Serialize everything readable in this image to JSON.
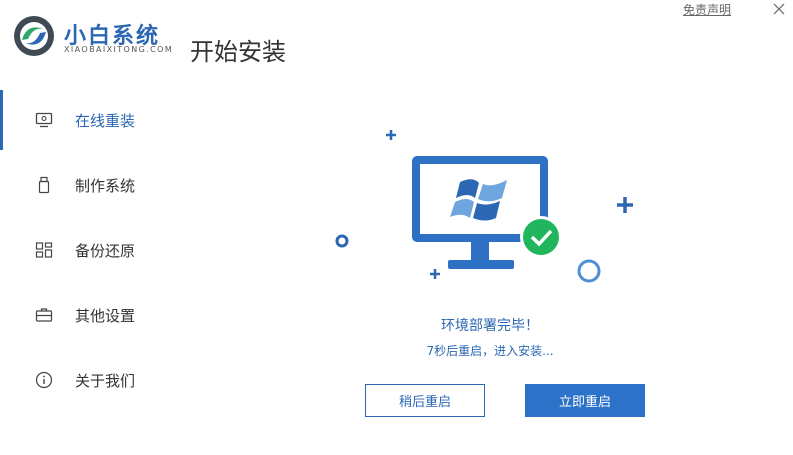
{
  "header": {
    "brand_name": "小白系统",
    "brand_sub": "XIAOBAIXITONG.COM",
    "page_title": "开始安装",
    "disclaimer": "免责声明"
  },
  "sidebar": {
    "items": [
      {
        "label": "在线重装",
        "icon": "monitor-icon",
        "active": true
      },
      {
        "label": "制作系统",
        "icon": "usb-icon",
        "active": false
      },
      {
        "label": "备份还原",
        "icon": "backup-icon",
        "active": false
      },
      {
        "label": "其他设置",
        "icon": "briefcase-icon",
        "active": false
      },
      {
        "label": "关于我们",
        "icon": "info-icon",
        "active": false
      }
    ]
  },
  "main": {
    "status": "环境部署完毕！",
    "countdown": "7秒后重启，进入安装...",
    "btn_later": "稍后重启",
    "btn_now": "立即重启"
  },
  "colors": {
    "accent": "#2b67b3",
    "button": "#2b72c8",
    "success": "#21b55e"
  }
}
